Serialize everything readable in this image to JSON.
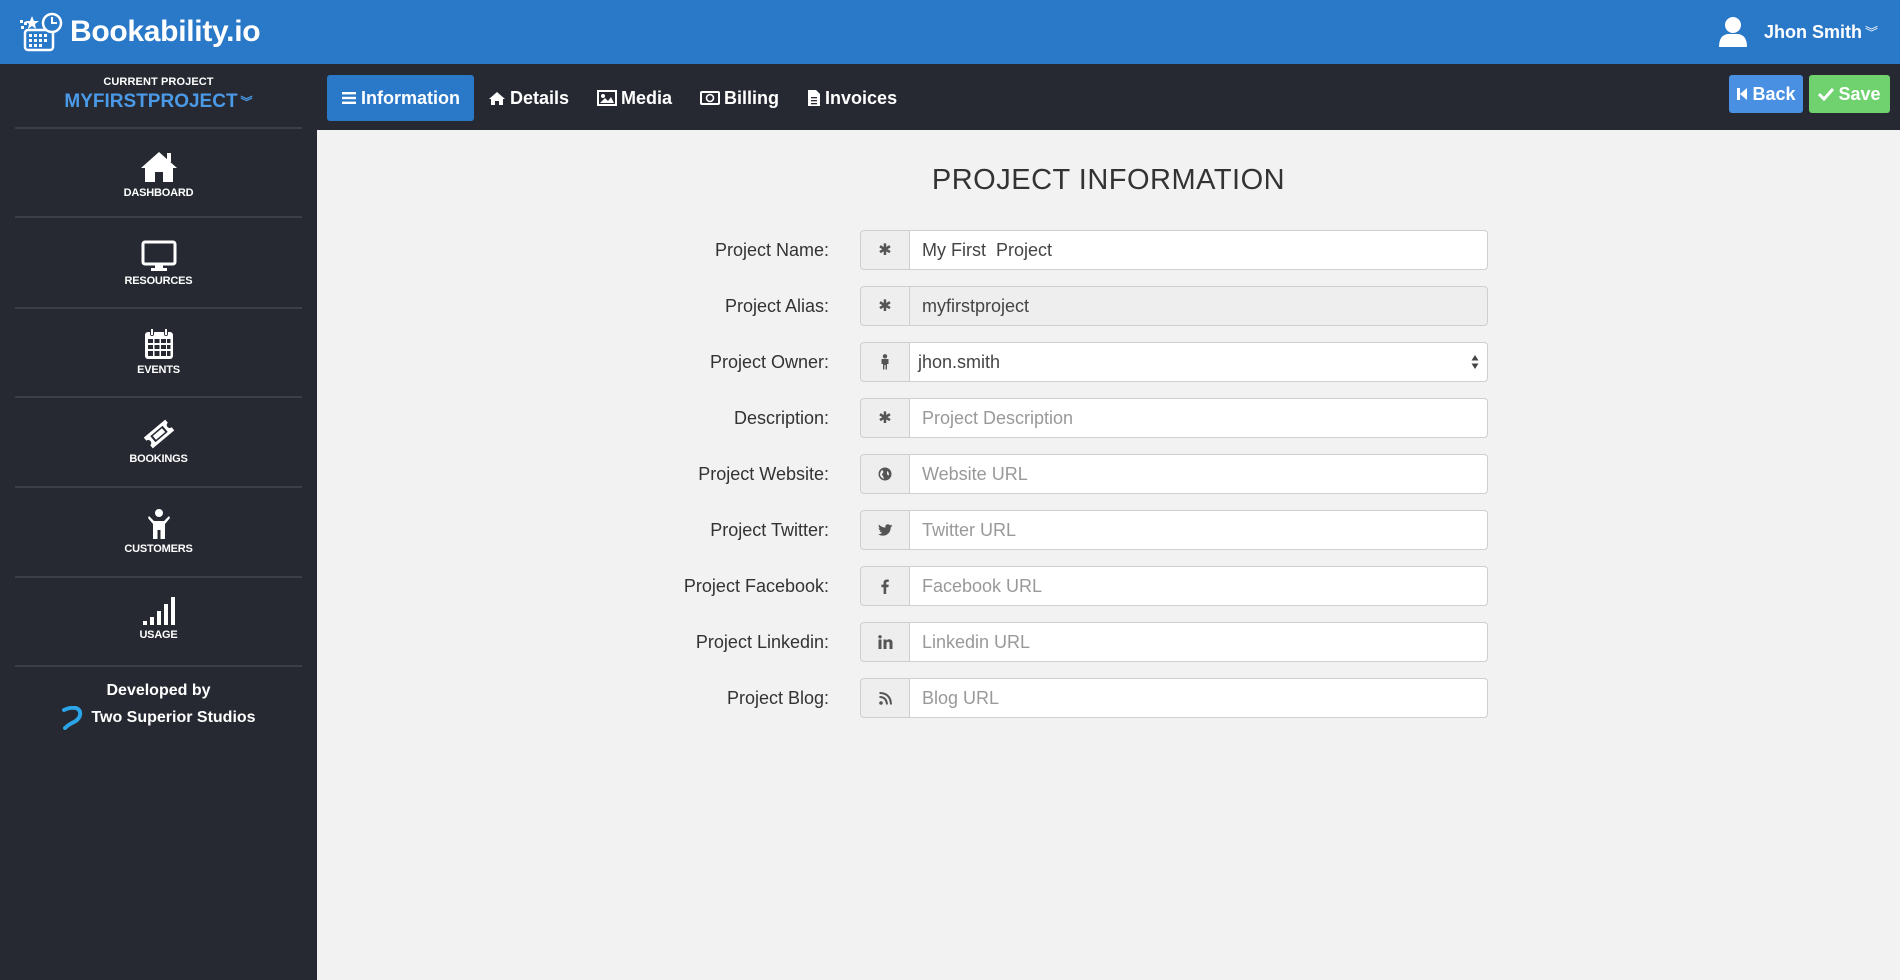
{
  "app": {
    "brand_name": "Bookability.io",
    "brand_color": "#2a78c8",
    "user_name": "Jhon Smith"
  },
  "sidebar": {
    "current_project_label": "CURRENT PROJECT",
    "current_project_name": "MYFIRSTPROJECT",
    "items": [
      {
        "label": "DASHBOARD",
        "icon": "home-icon"
      },
      {
        "label": "RESOURCES",
        "icon": "monitor-icon"
      },
      {
        "label": "EVENTS",
        "icon": "calendar-icon"
      },
      {
        "label": "BOOKINGS",
        "icon": "ticket-icon"
      },
      {
        "label": "CUSTOMERS",
        "icon": "person-icon"
      },
      {
        "label": "USAGE",
        "icon": "signal-bars-icon"
      }
    ],
    "developed_by": "Developed by",
    "developer": "Two Superior Studios"
  },
  "navbar": {
    "tabs": [
      {
        "label": "Information",
        "icon": "list-icon",
        "active": true
      },
      {
        "label": "Details",
        "icon": "home-icon",
        "active": false
      },
      {
        "label": "Media",
        "icon": "image-icon",
        "active": false
      },
      {
        "label": "Billing",
        "icon": "money-icon",
        "active": false
      },
      {
        "label": "Invoices",
        "icon": "document-icon",
        "active": false
      }
    ],
    "back_label": "Back",
    "save_label": "Save"
  },
  "form": {
    "title": "PROJECT INFORMATION",
    "fields": [
      {
        "label": "Project Name:",
        "icon": "asterisk-icon",
        "value": "My First  Project",
        "placeholder": ""
      },
      {
        "label": "Project Alias:",
        "icon": "asterisk-icon",
        "value": "myfirstproject",
        "placeholder": "",
        "readonly": true
      },
      {
        "label": "Project Owner:",
        "icon": "male-icon",
        "value": "jhon.smith",
        "type": "select"
      },
      {
        "label": "Description:",
        "icon": "asterisk-icon",
        "value": "",
        "placeholder": "Project Description"
      },
      {
        "label": "Project Website:",
        "icon": "globe-icon",
        "value": "",
        "placeholder": "Website URL"
      },
      {
        "label": "Project Twitter:",
        "icon": "twitter-icon",
        "value": "",
        "placeholder": "Twitter URL"
      },
      {
        "label": "Project Facebook:",
        "icon": "facebook-icon",
        "value": "",
        "placeholder": "Facebook URL"
      },
      {
        "label": "Project Linkedin:",
        "icon": "linkedin-icon",
        "value": "",
        "placeholder": "Linkedin URL"
      },
      {
        "label": "Project Blog:",
        "icon": "rss-icon",
        "value": "",
        "placeholder": "Blog URL"
      }
    ]
  }
}
